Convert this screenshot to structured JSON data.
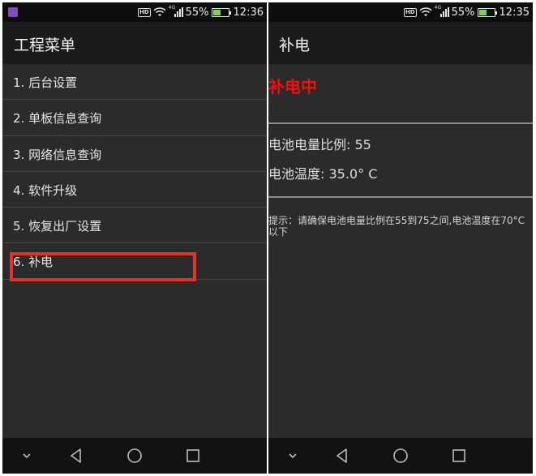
{
  "left_screen": {
    "status": {
      "battery": "55%",
      "time": "12:36",
      "network": "4G"
    },
    "title": "工程菜单",
    "menu_items": [
      {
        "label": "1. 后台设置"
      },
      {
        "label": "2. 单板信息查询"
      },
      {
        "label": "3. 网络信息查询"
      },
      {
        "label": "4. 软件升级"
      },
      {
        "label": "5. 恢复出厂设置"
      },
      {
        "label": "6. 补电"
      }
    ]
  },
  "right_screen": {
    "status": {
      "battery": "55%",
      "time": "12:35",
      "network": "4G"
    },
    "title": "补电",
    "charging_status": "补电中",
    "battery_level": "电池电量比例: 55",
    "battery_temperature": "电池温度: 35.0° C",
    "tip": "提示：请确保电池电量比例在55到75之间,电池温度在70°C以下"
  },
  "colors": {
    "background": "#2b2b2b",
    "app_bar": "#1b1b1b",
    "status_bar": "#0e0e0e",
    "highlight": "#e8302a",
    "charging_red": "#ee1111"
  },
  "battery_fraction": 0.55,
  "icons": [
    "hd-icon",
    "wifi-icon",
    "signal-icon",
    "battery-icon",
    "back-icon",
    "home-icon",
    "recents-icon",
    "nav-down-icon"
  ]
}
